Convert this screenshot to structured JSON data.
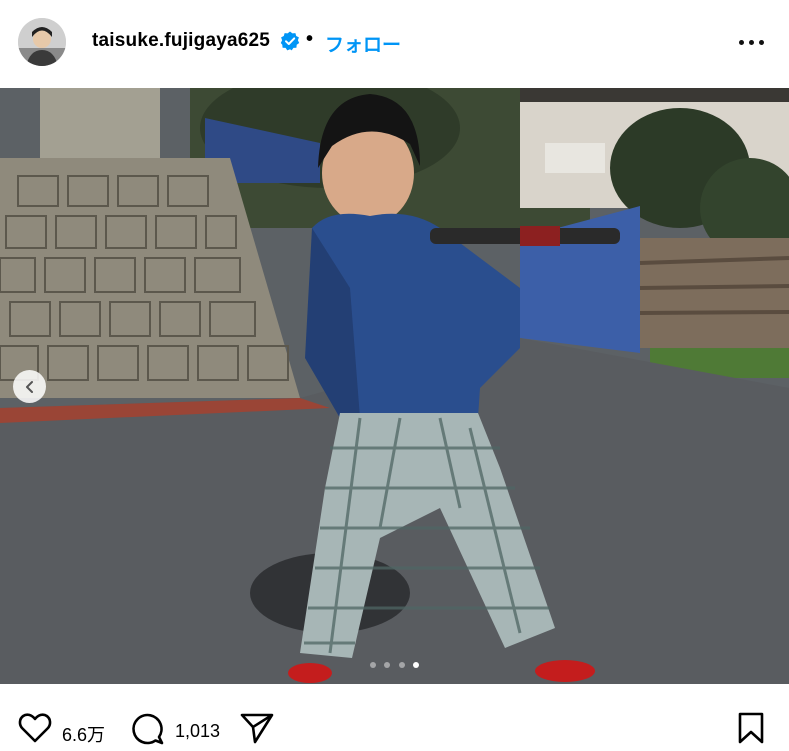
{
  "post": {
    "username": "taisuke.fujigaya625",
    "separator": "•",
    "follow_label": "フォロー",
    "likes": "6.6万",
    "comments": "1,013"
  },
  "carousel": {
    "total": 4,
    "active_index": 3
  },
  "icons": {
    "verified": "verified-badge-icon",
    "more": "more-options-icon",
    "prev": "chevron-left-icon",
    "like": "heart-icon",
    "comment": "comment-icon",
    "share": "share-icon",
    "save": "bookmark-icon"
  },
  "colors": {
    "accent": "#0095f6",
    "verified": "#0095f6"
  }
}
